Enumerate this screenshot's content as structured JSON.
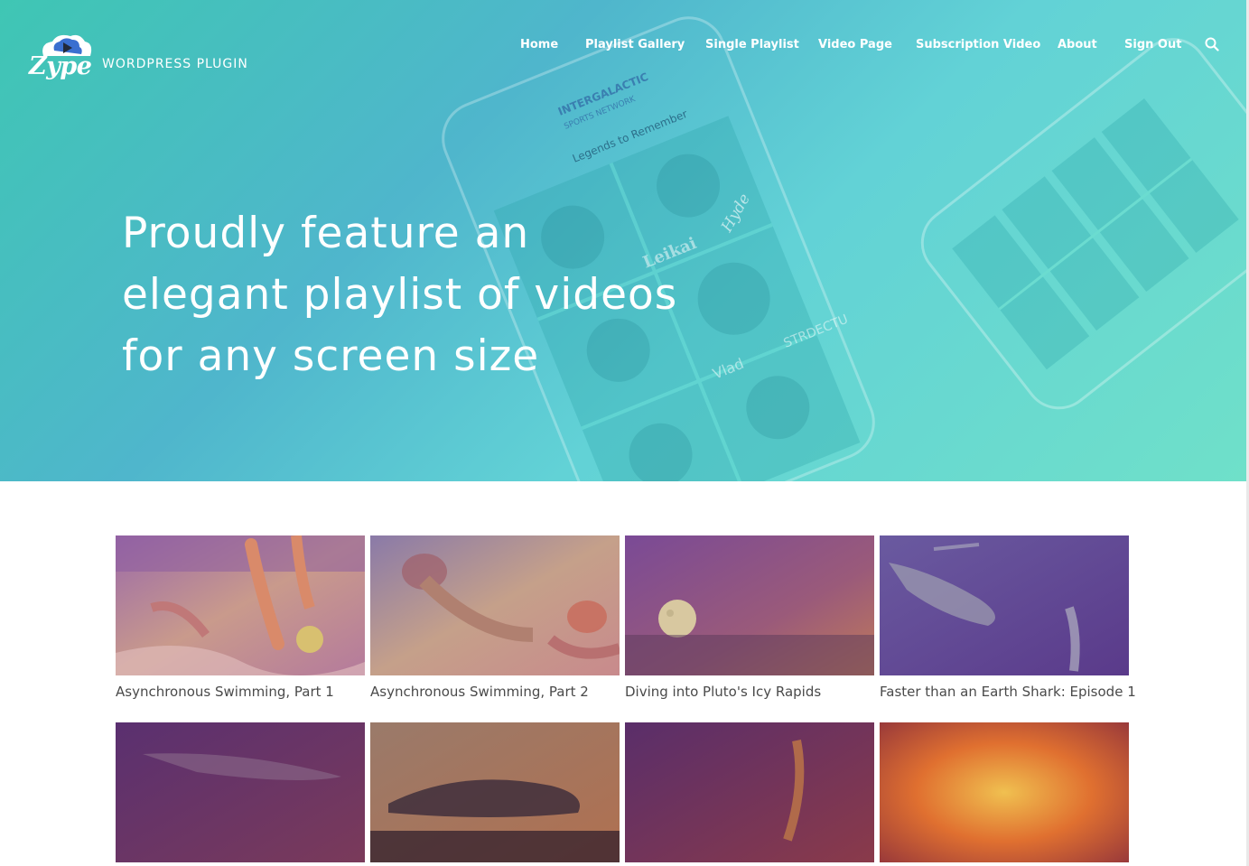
{
  "brand": {
    "logo_text": "Zype",
    "subtitle": "WORDPRESS PLUGIN"
  },
  "nav": {
    "items": [
      {
        "label": "Home"
      },
      {
        "label": "Playlist Gallery"
      },
      {
        "label": "Single Playlist"
      },
      {
        "label": "Video Page"
      },
      {
        "label": "Subscription Video"
      },
      {
        "label": "About"
      },
      {
        "label": "Sign Out"
      }
    ],
    "search_icon": "search-icon"
  },
  "hero": {
    "title": "Proudly feature an elegant playlist of videos for any screen size",
    "mockup": {
      "network_name": "INTERGALACTIC",
      "network_sub": "SPORTS NETWORK",
      "heading": "Legends to Remember",
      "tiles": [
        "Hyde",
        "Leikai",
        "Vlad",
        "STRDECTU"
      ]
    }
  },
  "videos": [
    {
      "title": "Asynchronous Swimming, Part 1"
    },
    {
      "title": "Asynchronous Swimming, Part 2"
    },
    {
      "title": "Diving into Pluto's Icy Rapids"
    },
    {
      "title": "Faster than an Earth Shark: Episode 1"
    },
    {
      "title": ""
    },
    {
      "title": ""
    },
    {
      "title": ""
    },
    {
      "title": ""
    }
  ],
  "colors": {
    "hero_teal": "#4fc3c4",
    "overlay_purple": "#7a4aa0",
    "overlay_orange": "#e08a3a",
    "caption_text": "#4a4a4a"
  }
}
